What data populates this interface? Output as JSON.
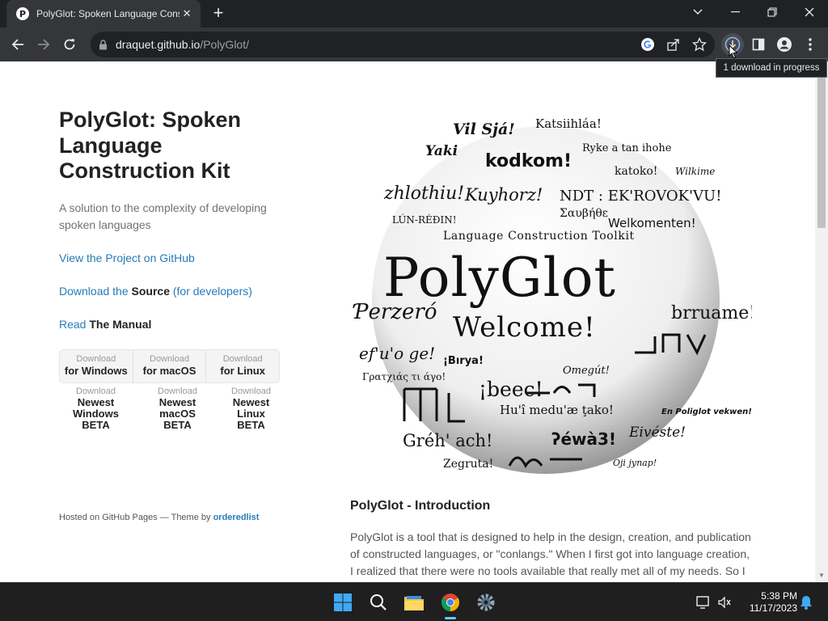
{
  "browser": {
    "tab_title": "PolyGlot: Spoken Language Construction Kit",
    "tab_favicon": "P",
    "url_host": "draquet.github.io",
    "url_path": "/PolyGlot/",
    "download_tooltip": "1 download in progress"
  },
  "page": {
    "title": "PolyGlot: Spoken Language Construction Kit",
    "subtitle": "A solution to the complexity of developing spoken languages",
    "github_link": "View the Project on GitHub",
    "download_source_prefix": "Download the",
    "download_source_bold": "Source",
    "download_source_suffix": "(for developers)",
    "read_prefix": "Read",
    "read_bold": "The Manual",
    "downloads": [
      {
        "small": "Download",
        "big": "for Windows"
      },
      {
        "small": "Download",
        "big": "for macOS"
      },
      {
        "small": "Download",
        "big": "for Linux"
      }
    ],
    "beta_downloads": [
      {
        "small": "Download",
        "big": "Newest Windows BETA"
      },
      {
        "small": "Download",
        "big": "Newest macOS BETA"
      },
      {
        "small": "Download",
        "big": "Newest Linux BETA"
      }
    ],
    "hosted_prefix": "Hosted on GitHub Pages — Theme by",
    "hosted_link": "orderedlist",
    "intro_title": "PolyGlot - Introduction",
    "intro_text": "PolyGlot is a tool that is designed to help in the design, creation, and publication of constructed languages, or \"conlangs.\" When I first got into language creation, I realized that there were no tools available that really met all of my needs. So I",
    "logo": {
      "main": "PolyGlot",
      "toolkit": "Language Construction Toolkit",
      "welcome": "Welcome!",
      "words": [
        "Vil Sjá!",
        "Katsiihláa!",
        "Yaki",
        "kodkom!",
        "Ryke a tan ihohe",
        "katoko!",
        "Wilkime",
        "zhlothiu!",
        "Kuyhorz!",
        "NDT : EK'ROVOK'VU!",
        "Σαυβήθε",
        "LÚN-RÉÐIN!",
        "Welkomenten!",
        "Ƥerzeró",
        "brruame!",
        "ef'u'o ge!",
        "¡Bırya!",
        "Omegút!",
        "Γρατχιάς τι άγο!",
        "¡beec!",
        "Hu'î medu'æ ţako!",
        "En Poliglot vekwen!",
        "Eivéste!",
        "Gréh' ach!",
        "ʔéwà3!",
        "Oji jynap!",
        "Zegruta!"
      ]
    }
  },
  "taskbar": {
    "time": "5:38 PM",
    "date": "11/17/2023"
  }
}
